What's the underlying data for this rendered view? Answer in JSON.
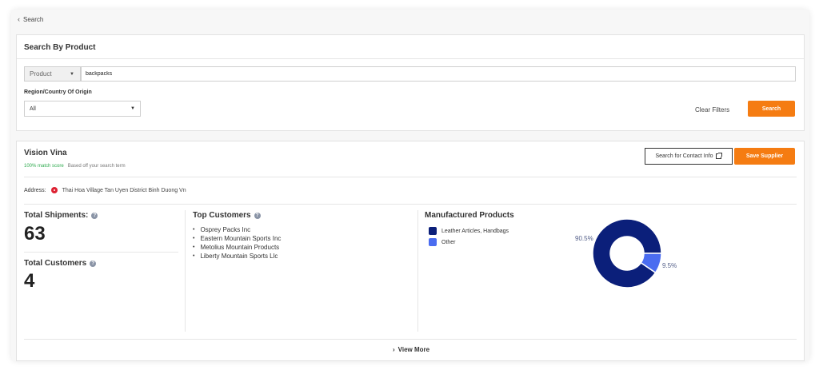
{
  "nav": {
    "back_label": "Search"
  },
  "search_card": {
    "title": "Search By Product",
    "type_select": "Product",
    "query_value": "backpacks",
    "region_label": "Region/Country Of Origin",
    "region_value": "All",
    "clear_filters": "Clear Filters",
    "search_button": "Search"
  },
  "supplier": {
    "name": "Vision Vina",
    "match_score": "100% match score",
    "match_note": "Based off your search term",
    "contact_button": "Search for Contact Info",
    "save_button": "Save Supplier",
    "address_label": "Address:",
    "address": "Thai Hoa Village Tan Uyen District Binh Duong Vn",
    "total_shipments_label": "Total Shipments:",
    "total_shipments": "63",
    "total_customers_label": "Total Customers",
    "total_customers": "4",
    "top_customers_label": "Top Customers",
    "top_customers": [
      "Osprey Packs Inc",
      "Eastern Mountain Sports Inc",
      "Metolius Mountain Products",
      "Liberty Mountain Sports Llc"
    ],
    "manufactured_label": "Manufactured Products",
    "view_more": "View More"
  },
  "chart_data": {
    "type": "pie",
    "categories": [
      "Leather Articles, Handbags",
      "Other"
    ],
    "values": [
      90.5,
      9.5
    ],
    "labels": [
      "90.5%",
      "9.5%"
    ],
    "colors": [
      "#0b1f7a",
      "#4a6cf0"
    ],
    "legend": "left"
  }
}
